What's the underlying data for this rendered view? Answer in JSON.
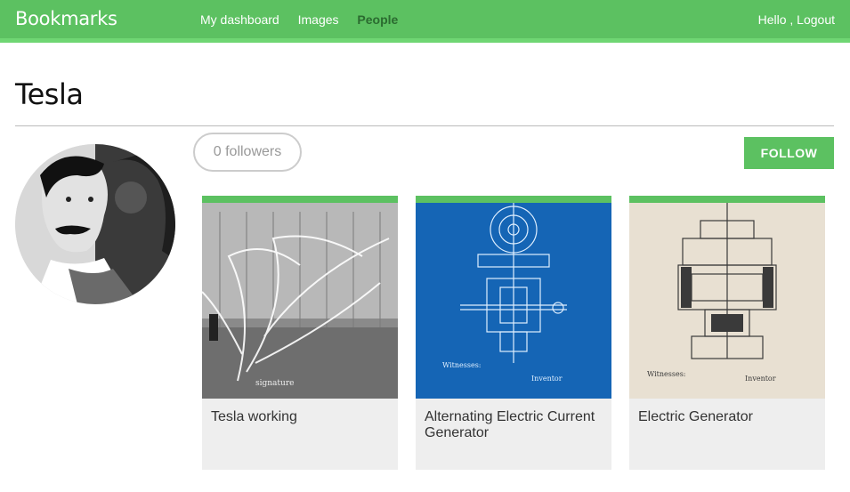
{
  "header": {
    "logo": "Bookmarks",
    "nav": [
      {
        "label": "My dashboard",
        "active": false
      },
      {
        "label": "Images",
        "active": false
      },
      {
        "label": "People",
        "active": true
      }
    ],
    "greeting": "Hello ,",
    "logout": "Logout"
  },
  "profile": {
    "name": "Tesla",
    "followers_label": "0 followers",
    "follow_button": "FOLLOW"
  },
  "images": [
    {
      "title": "Tesla working"
    },
    {
      "title": "Alternating Electric Current Generator"
    },
    {
      "title": "Electric Generator"
    }
  ],
  "colors": {
    "accent": "#5cc161",
    "active_nav": "#2b6b30"
  }
}
